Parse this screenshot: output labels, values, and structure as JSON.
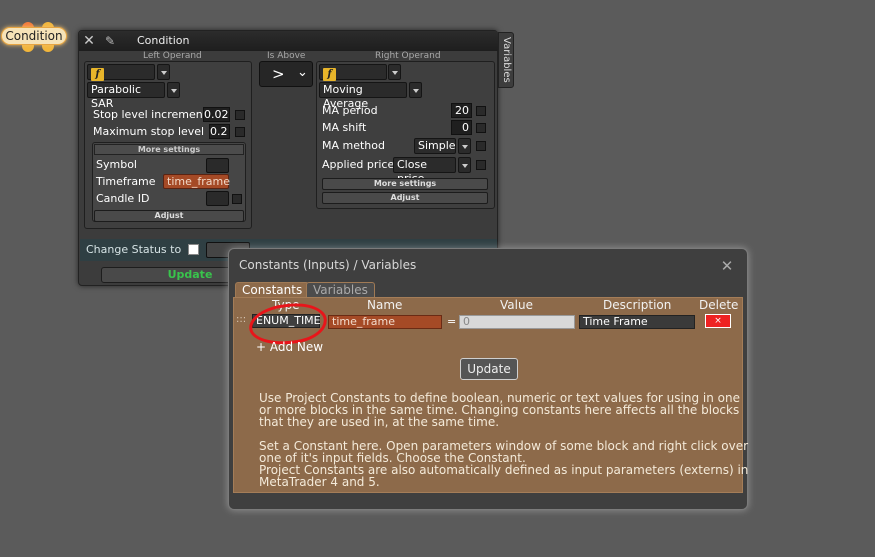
{
  "node": {
    "label": "Condition"
  },
  "condition": {
    "title": "Condition",
    "left_operand_label": "Left Operand",
    "is_above_label": "Is Above",
    "right_operand_label": "Right Operand",
    "vertical_tab": "Variables",
    "left": {
      "type": "Indicator",
      "indicator": "Parabolic SAR",
      "params": [
        {
          "label": "Stop level increment",
          "value": "0.02"
        },
        {
          "label": "Maximum stop level",
          "value": "0.2"
        }
      ],
      "more_settings": "More settings",
      "more": [
        {
          "label": "Symbol",
          "value": ""
        },
        {
          "label": "Timeframe",
          "value": "time_frame"
        },
        {
          "label": "Candle ID",
          "value": ""
        }
      ],
      "adjust": "Adjust"
    },
    "operator": ">",
    "right": {
      "type": "Indicator",
      "indicator": "Moving Average",
      "params": [
        {
          "label": "MA period",
          "value": "20"
        },
        {
          "label": "MA shift",
          "value": "0"
        },
        {
          "label": "MA method",
          "value": "Simple"
        },
        {
          "label": "Applied price",
          "value": "Close price"
        }
      ],
      "more_settings": "More settings",
      "adjust": "Adjust"
    },
    "change_status_label": "Change Status to",
    "update_label": "Update"
  },
  "constants_dialog": {
    "title": "Constants (Inputs) / Variables",
    "tabs": [
      "Constants",
      "Variables"
    ],
    "columns": {
      "type": "Type",
      "name": "Name",
      "value": "Value",
      "description": "Description",
      "delete": "Delete"
    },
    "rows": [
      {
        "handle": ":::",
        "type": "ENUM_TIME",
        "name": "time_frame",
        "equals": "=",
        "value": "0",
        "description": "Time Frame",
        "delete": "×"
      }
    ],
    "add_new": "+ Add New",
    "update_label": "Update",
    "help_1": "Use Project Constants to define boolean, numeric or text values for using in one or more blocks in the same time. Changing constants here affects all the blocks that they are used in, at the same time.",
    "help_2": "Set a Constant here. Open parameters window of some block and right click over one of it's input fields. Choose the Constant.",
    "help_3": "Project Constants are also automatically defined as input parameters (externs) in MetaTrader 4 and 5."
  },
  "colors": {
    "background": "#5b5b5b",
    "dialog_content": "#8d6a4a",
    "accent_orange": "#a54a26",
    "update_green": "#39c44c",
    "annotation_red": "#e8151a"
  }
}
